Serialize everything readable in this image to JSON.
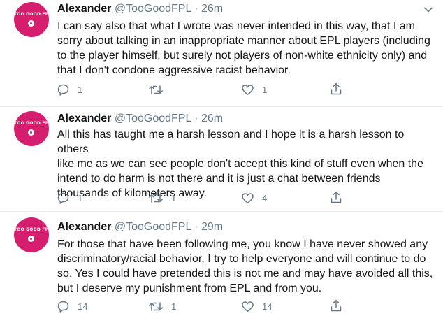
{
  "tweets": [
    {
      "author_name": "Alexander",
      "handle": "@TooGoodFPL",
      "separator": "·",
      "time": "26m",
      "avatar_text": "TOO GOOD FPL",
      "text": "I can say also that what I wrote was never intended in this way, that I am\nsorry about talking in an inappropriate manner about EPL players (including\nto the player himself, but surely not players of non-white ethnicity only) and\nthat I don't condone aggressive racist behavior.",
      "replies": "1",
      "retweets": "",
      "likes": "1"
    },
    {
      "author_name": "Alexander",
      "handle": "@TooGoodFPL",
      "separator": "·",
      "time": "26m",
      "avatar_text": "TOO GOOD FPL",
      "text": "All this has taught me a harsh lesson and I hope it is a harsh lesson to others\nlike me as we can see people don't accept this kind of stuff even when the\nintend to do harm is not there and it is just a chat between friends\nthousands of kilometers away.",
      "replies": "1",
      "retweets": "1",
      "likes": "4"
    },
    {
      "author_name": "Alexander",
      "handle": "@TooGoodFPL",
      "separator": "·",
      "time": "29m",
      "avatar_text": "TOO GOOD FPL",
      "text": "For those that have been following me, you know I have never showed any\ndiscriminatory/racial behavior, I try to help everyone and will continue to do\nso. Yes I could have pretended this is not me and may have avoided all this,\nbut I deserve my punishment from EPL and from you.",
      "replies": "14",
      "retweets": "1",
      "likes": "14"
    }
  ],
  "icons": {
    "reply": "reply-icon",
    "retweet": "retweet-icon",
    "like": "heart-icon",
    "share": "share-icon",
    "menu": "chevron-down-icon"
  },
  "colors": {
    "avatar_bg": "#d61e6e",
    "text": "#14171a",
    "muted": "#657786",
    "divider": "#e6ecf0"
  }
}
